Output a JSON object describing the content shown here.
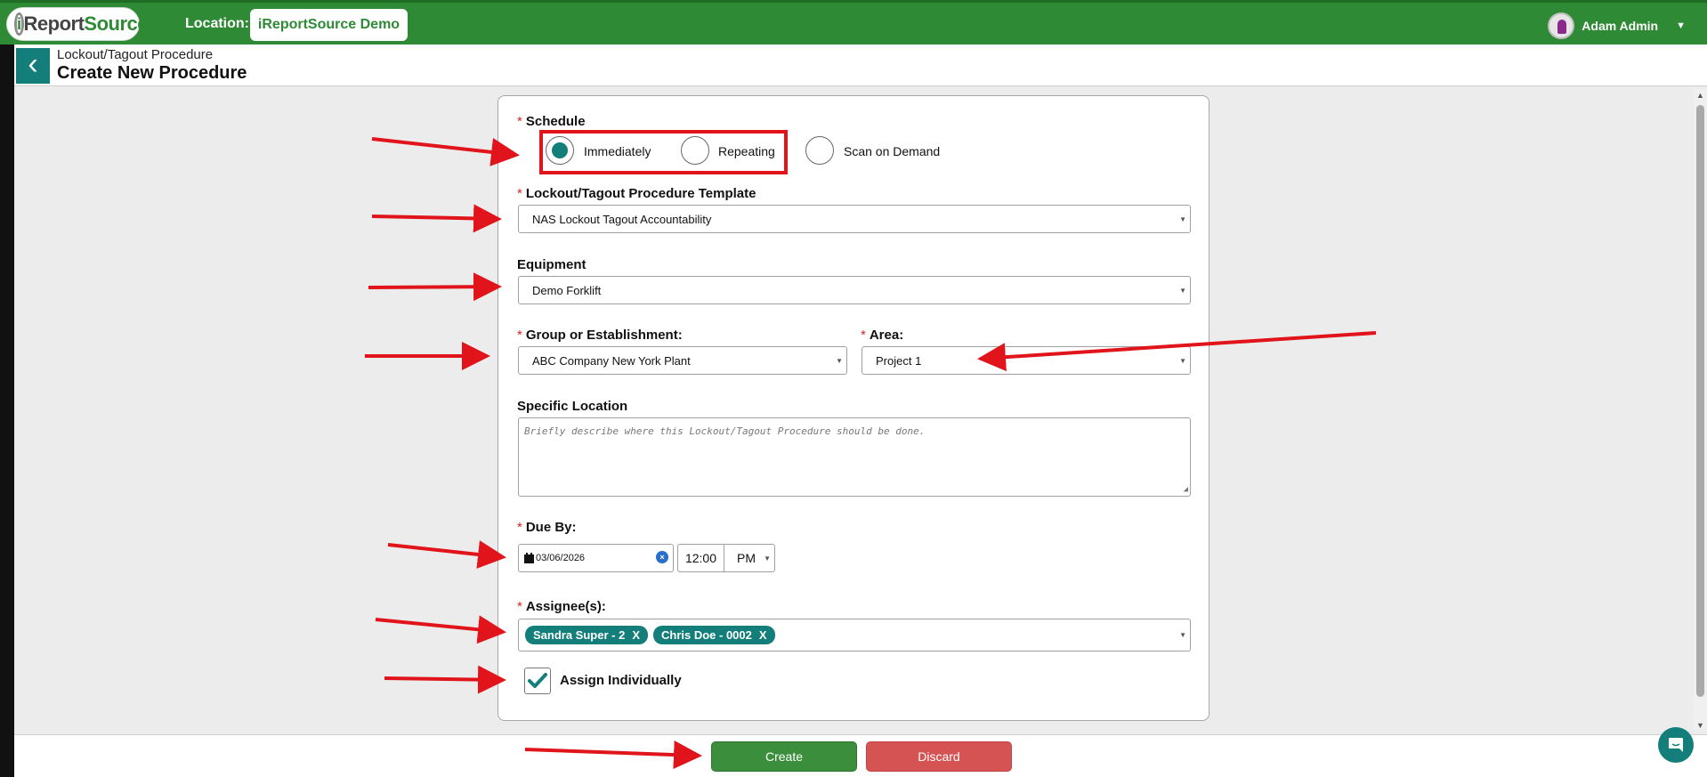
{
  "header": {
    "logo_prefix": "i",
    "logo_report": "Report",
    "logo_source": "Source",
    "location_label": "Location:",
    "location_value": "iReportSource Demo",
    "user_name": "Adam Admin",
    "user_caret": "▼"
  },
  "subheader": {
    "back_glyph": "‹",
    "breadcrumb": "Lockout/Tagout Procedure",
    "title": "Create New Procedure"
  },
  "form": {
    "required_mark": "*",
    "schedule": {
      "label": "Schedule",
      "options": [
        "Immediately",
        "Repeating",
        "Scan on Demand"
      ],
      "selected": "Immediately"
    },
    "template": {
      "label": "Lockout/Tagout Procedure Template",
      "value": "NAS Lockout Tagout Accountability"
    },
    "equipment": {
      "label": "Equipment",
      "value": "Demo Forklift"
    },
    "group": {
      "label": "Group or Establishment:",
      "value": "ABC Company New York Plant"
    },
    "area": {
      "label": "Area:",
      "value": "Project 1"
    },
    "specific_location": {
      "label": "Specific Location",
      "placeholder": "Briefly describe where this Lockout/Tagout Procedure should be done."
    },
    "due_by": {
      "label": "Due By:",
      "date": "03/06/2026",
      "time": "12:00",
      "ampm": "PM",
      "clear_glyph": "×"
    },
    "assignees": {
      "label": "Assignee(s):",
      "tags": [
        "Sandra Super - 2",
        "Chris Doe - 0002"
      ],
      "remove_glyph": "X"
    },
    "assign_individually": {
      "label": "Assign Individually",
      "checked": true
    }
  },
  "footer": {
    "create_label": "Create",
    "discard_label": "Discard"
  },
  "colors": {
    "brand_green": "#2e8a34",
    "teal": "#147e7a",
    "annotation_red": "#e0141a",
    "discard_red": "#d65353"
  }
}
